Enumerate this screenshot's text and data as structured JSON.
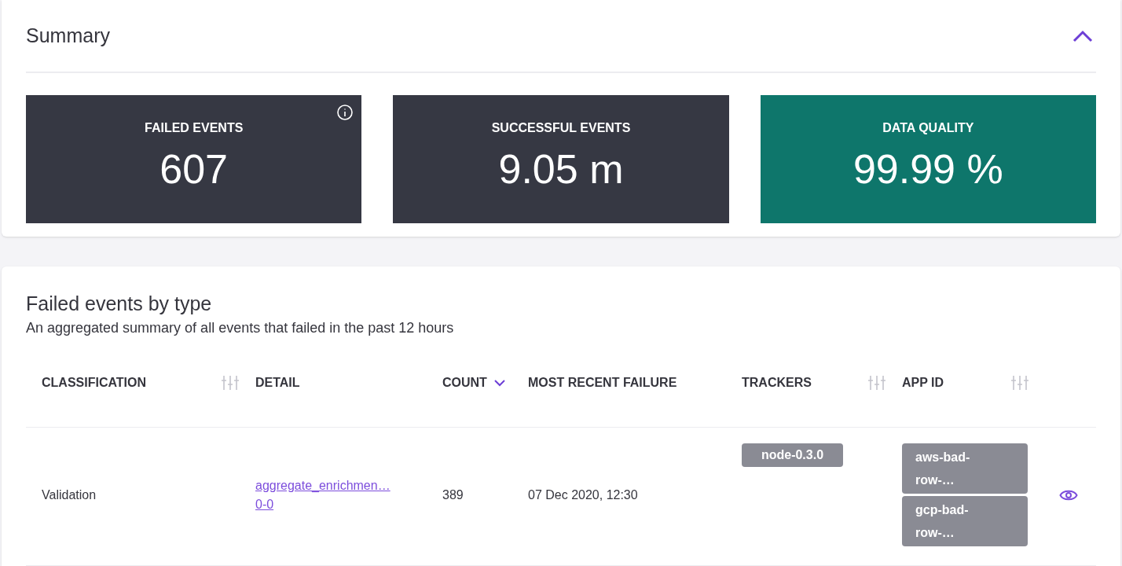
{
  "summary": {
    "title": "Summary",
    "expanded": true,
    "stats": [
      {
        "label": "FAILED EVENTS",
        "value": "607",
        "color": "#363843",
        "info": true
      },
      {
        "label": "SUCCESSFUL EVENTS",
        "value": "9.05 m",
        "color": "#363843",
        "info": false
      },
      {
        "label": "DATA QUALITY",
        "value": "99.99 %",
        "color": "#0e766b",
        "info": false
      }
    ]
  },
  "failed_by_type": {
    "title": "Failed events by type",
    "subtitle": "An aggregated summary of all events that failed in the past 12 hours",
    "table": {
      "columns": [
        {
          "label": "CLASSIFICATION",
          "kind": "filter"
        },
        {
          "label": "DETAIL",
          "kind": "plain"
        },
        {
          "label": "COUNT",
          "kind": "sort"
        },
        {
          "label": "MOST RECENT FAILURE",
          "kind": "plain"
        },
        {
          "label": "TRACKERS",
          "kind": "filter"
        },
        {
          "label": "APP ID",
          "kind": "filter"
        }
      ],
      "rows": [
        {
          "classification": "Validation",
          "detail": [
            "aggregate_enrichmen…",
            "0-0"
          ],
          "count": "389",
          "most_recent_failure": "07 Dec 2020, 12:30",
          "trackers": [
            [
              "node-0.3.0"
            ]
          ],
          "app_ids": [
            [
              "aws-bad-",
              "row-…"
            ],
            [
              "gcp-bad-",
              "row-…"
            ]
          ]
        }
      ]
    }
  }
}
